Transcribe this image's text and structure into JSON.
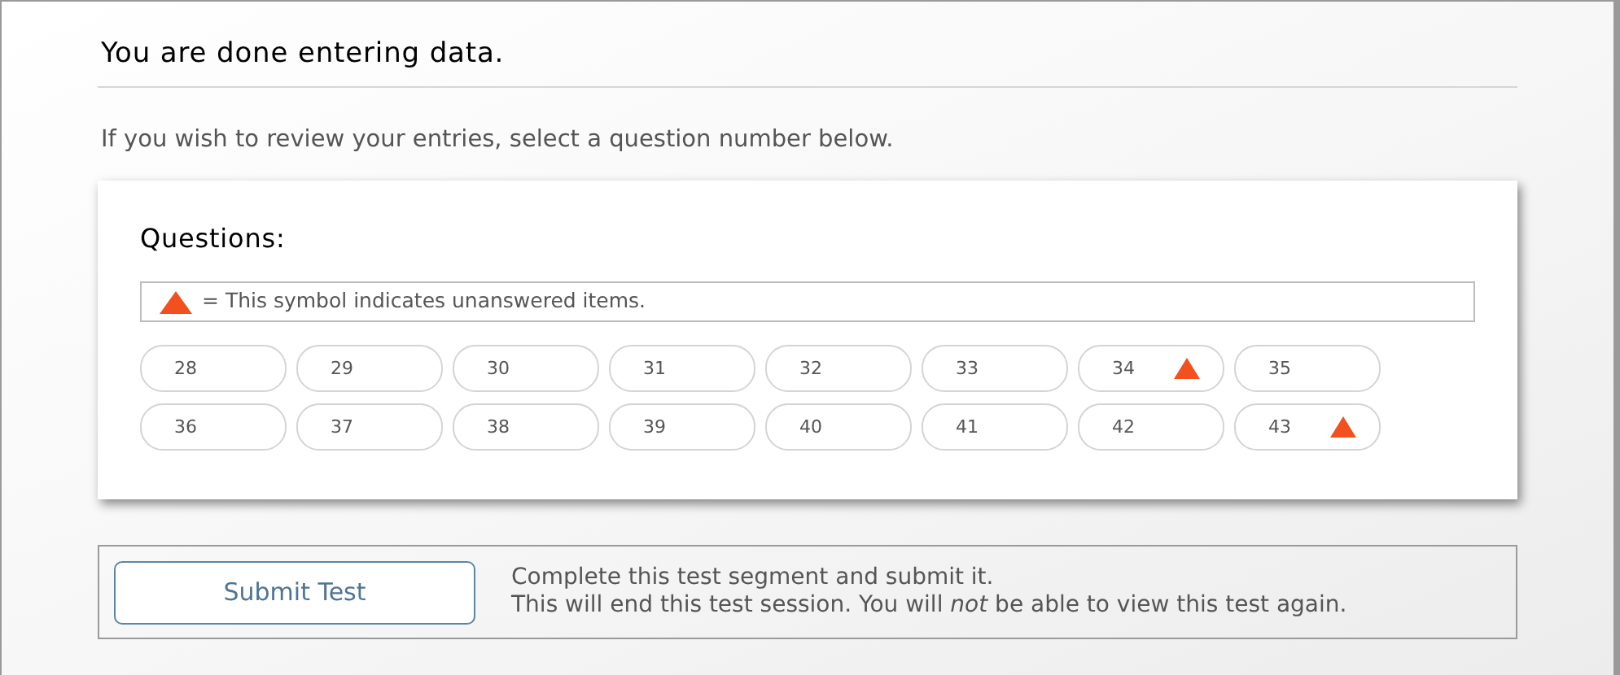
{
  "heading": "You are done entering data.",
  "instruction": "If you wish to review your entries, select a question number below.",
  "questions_panel": {
    "title": "Questions:",
    "legend": "= This symbol indicates unanswered items.",
    "items": [
      {
        "number": "28",
        "unanswered": false
      },
      {
        "number": "29",
        "unanswered": false
      },
      {
        "number": "30",
        "unanswered": false
      },
      {
        "number": "31",
        "unanswered": false
      },
      {
        "number": "32",
        "unanswered": false
      },
      {
        "number": "33",
        "unanswered": false
      },
      {
        "number": "34",
        "unanswered": true
      },
      {
        "number": "35",
        "unanswered": false
      },
      {
        "number": "36",
        "unanswered": false
      },
      {
        "number": "37",
        "unanswered": false
      },
      {
        "number": "38",
        "unanswered": false
      },
      {
        "number": "39",
        "unanswered": false
      },
      {
        "number": "40",
        "unanswered": false
      },
      {
        "number": "41",
        "unanswered": false
      },
      {
        "number": "42",
        "unanswered": false
      },
      {
        "number": "43",
        "unanswered": true
      }
    ]
  },
  "submit": {
    "button": "Submit Test",
    "lines": [
      "Complete this test segment and submit it.",
      "This will end this test session. You will *not* be able to view this test again."
    ]
  }
}
